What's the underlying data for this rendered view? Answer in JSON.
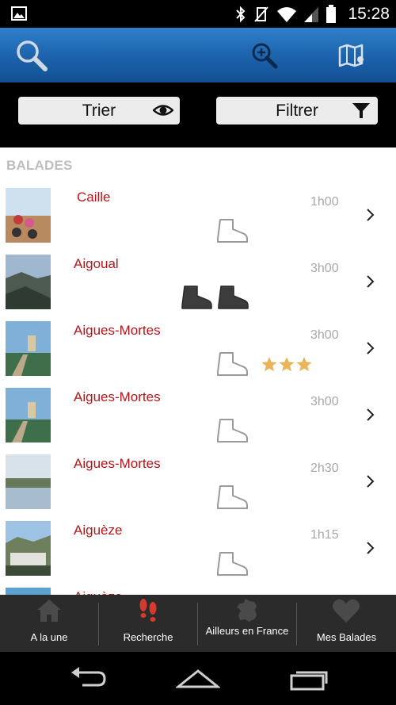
{
  "status_bar": {
    "time": "15:28",
    "icons": [
      "image-icon",
      "bluetooth-icon",
      "vibrate-icon",
      "wifi-icon",
      "signal-icon",
      "battery-icon"
    ]
  },
  "app_bar": {
    "icons": [
      "search-icon",
      "zoom-icon",
      "map-icon"
    ],
    "color": "#1a5fa8"
  },
  "toolbar": {
    "sort_label": "Trier",
    "filter_label": "Filtrer"
  },
  "list": {
    "section_title": "BALADES",
    "items": [
      {
        "name": "Caille",
        "duration": "1h00",
        "difficulty": 1,
        "stars": 0
      },
      {
        "name": "Aigoual",
        "duration": "3h00",
        "difficulty": 2,
        "stars": 0
      },
      {
        "name": "Aigues-Mortes",
        "duration": "3h00",
        "difficulty": 1,
        "stars": 3
      },
      {
        "name": "Aigues-Mortes",
        "duration": "3h00",
        "difficulty": 1,
        "stars": 0
      },
      {
        "name": "Aigues-Mortes",
        "duration": "2h30",
        "difficulty": 1,
        "stars": 0
      },
      {
        "name": "Aiguèze",
        "duration": "1h15",
        "difficulty": 1,
        "stars": 0
      },
      {
        "name": "Aiguèze",
        "duration": "",
        "difficulty": 0,
        "stars": 0
      }
    ]
  },
  "tabs": [
    {
      "label": "A la une",
      "icon": "home-icon",
      "active": false
    },
    {
      "label": "Recherche",
      "icon": "footprints-icon",
      "active": true
    },
    {
      "label": "Ailleurs en France",
      "icon": "france-map-icon",
      "active": false
    },
    {
      "label": "Mes Balades",
      "icon": "heart-icon",
      "active": false
    }
  ],
  "colors": {
    "accent_red": "#b3171c",
    "star": "#e9b45a",
    "tab_bg": "#2b2b2b"
  }
}
